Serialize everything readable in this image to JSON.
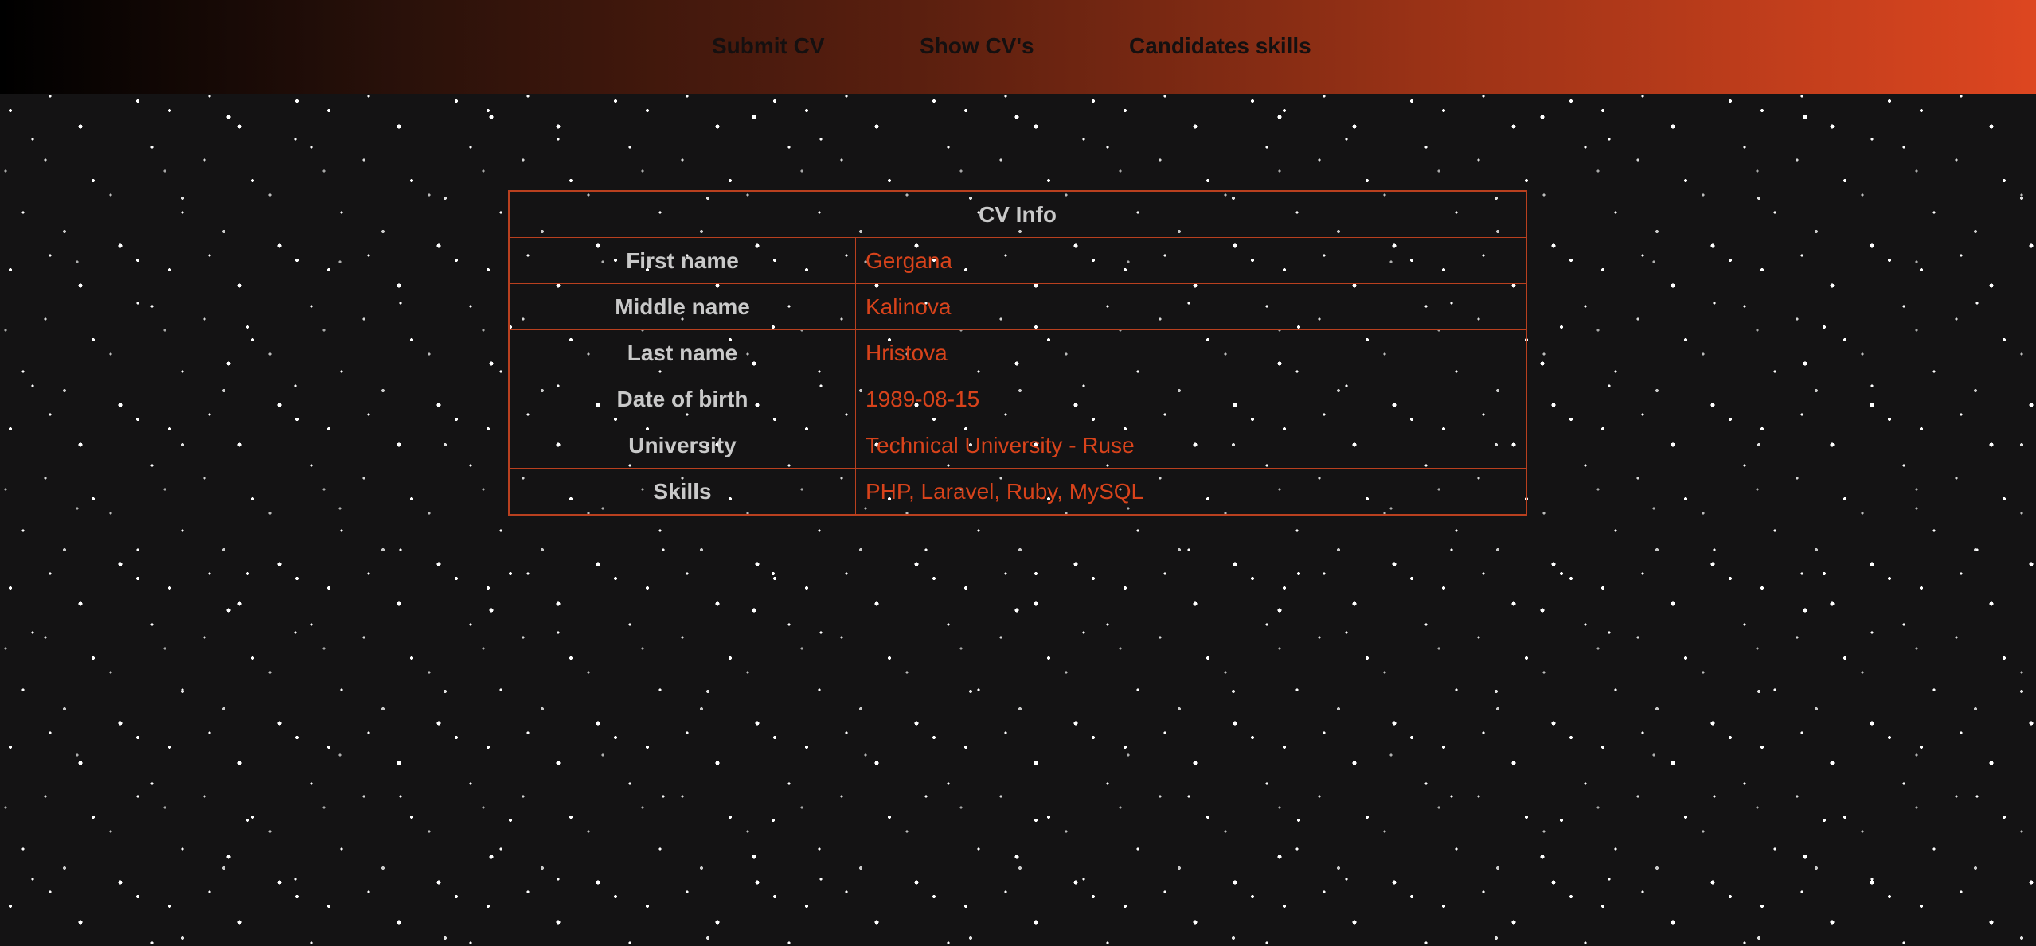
{
  "nav": {
    "items": [
      {
        "label": "Submit CV"
      },
      {
        "label": "Show CV's"
      },
      {
        "label": "Candidates skills"
      }
    ]
  },
  "cv": {
    "title": "CV Info",
    "rows": [
      {
        "label": "First name",
        "value": "Gergana"
      },
      {
        "label": "Middle name",
        "value": "Kalinova"
      },
      {
        "label": "Last name",
        "value": "Hristova"
      },
      {
        "label": "Date of birth",
        "value": "1989-08-15"
      },
      {
        "label": "University",
        "value": "Technical University - Ruse"
      },
      {
        "label": "Skills",
        "value": "PHP, Laravel, Ruby, MySQL"
      }
    ]
  },
  "colors": {
    "accent": "#d8431b",
    "header_gradient_start": "#000000",
    "header_gradient_end": "#dd4620",
    "background": "#141314",
    "label_text": "#c9c9c9"
  }
}
